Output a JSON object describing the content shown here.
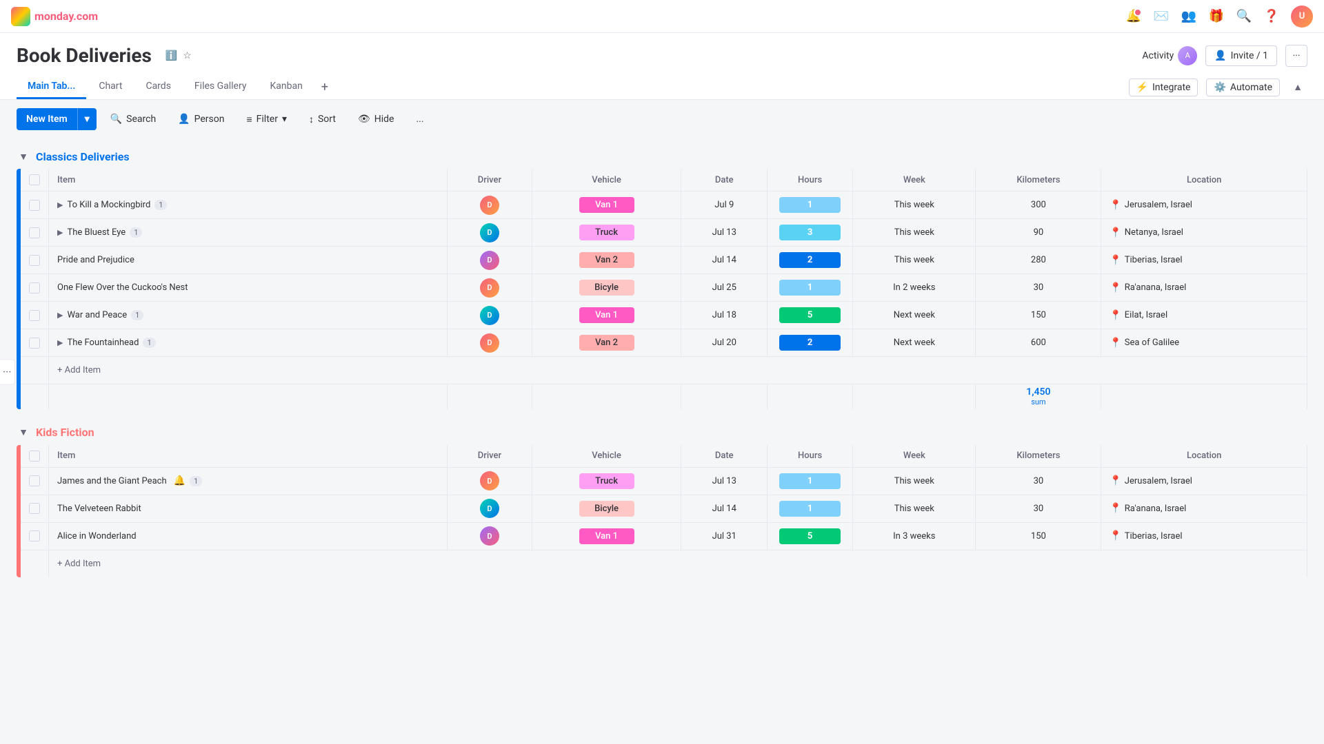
{
  "app": {
    "name": "monday.com"
  },
  "topnav": {
    "icons": [
      "bell",
      "inbox",
      "people",
      "gift",
      "search",
      "help"
    ]
  },
  "page": {
    "title": "Book Deliveries",
    "activity_label": "Activity",
    "invite_label": "Invite / 1",
    "more_label": "..."
  },
  "tabs": {
    "items": [
      {
        "label": "Main Tab...",
        "active": true
      },
      {
        "label": "Chart",
        "active": false
      },
      {
        "label": "Cards",
        "active": false
      },
      {
        "label": "Files Gallery",
        "active": false
      },
      {
        "label": "Kanban",
        "active": false
      }
    ],
    "integrate_label": "Integrate",
    "automate_label": "Automate"
  },
  "toolbar": {
    "new_item_label": "New Item",
    "search_label": "Search",
    "person_label": "Person",
    "filter_label": "Filter",
    "sort_label": "Sort",
    "hide_label": "Hide",
    "more_label": "..."
  },
  "groups": [
    {
      "id": "classics",
      "title": "Classics Deliveries",
      "color": "#0073ea",
      "columns": [
        "Item",
        "Driver",
        "Vehicle",
        "Date",
        "Hours",
        "Week",
        "Kilometers",
        "Location"
      ],
      "rows": [
        {
          "item": "To Kill a Mockingbird",
          "badge": "1",
          "expand": true,
          "vehicle": "Van 1",
          "vehicle_class": "van1",
          "date": "Jul 9",
          "hours": "1",
          "hours_class": "hours-1-light",
          "week": "This week",
          "km": "300",
          "location": "Jerusalem, Israel"
        },
        {
          "item": "The Bluest Eye",
          "badge": "1",
          "expand": true,
          "vehicle": "Truck",
          "vehicle_class": "truck",
          "date": "Jul 13",
          "hours": "3",
          "hours_class": "hours-3",
          "week": "This week",
          "km": "90",
          "location": "Netanya, Israel"
        },
        {
          "item": "Pride and Prejudice",
          "badge": "",
          "expand": false,
          "vehicle": "Van 2",
          "vehicle_class": "van2",
          "date": "Jul 14",
          "hours": "2",
          "hours_class": "hours-2-dark",
          "week": "This week",
          "km": "280",
          "location": "Tiberias, Israel"
        },
        {
          "item": "One Flew Over the Cuckoo's Nest",
          "badge": "",
          "expand": false,
          "vehicle": "Bicyle",
          "vehicle_class": "bicycle",
          "date": "Jul 25",
          "hours": "1",
          "hours_class": "hours-1-dark",
          "week": "In 2 weeks",
          "km": "30",
          "location": "Ra'anana, Israel"
        },
        {
          "item": "War and Peace",
          "badge": "1",
          "expand": true,
          "vehicle": "Van 1",
          "vehicle_class": "van1",
          "date": "Jul 18",
          "hours": "5",
          "hours_class": "hours-5",
          "week": "Next week",
          "km": "150",
          "location": "Eilat, Israel"
        },
        {
          "item": "The Fountainhead",
          "badge": "1",
          "expand": true,
          "vehicle": "Van 2",
          "vehicle_class": "van2",
          "date": "Jul 20",
          "hours": "2",
          "hours_class": "hours-2-blue",
          "week": "Next week",
          "km": "600",
          "location": "Sea of Galilee"
        }
      ],
      "add_item_label": "+ Add Item",
      "sum_km": "1,450",
      "sum_label": "sum"
    },
    {
      "id": "kids",
      "title": "Kids Fiction",
      "color": "#ff7575",
      "columns": [
        "Item",
        "Driver",
        "Vehicle",
        "Date",
        "Hours",
        "Week",
        "Kilometers",
        "Location"
      ],
      "rows": [
        {
          "item": "James and the Giant Peach",
          "badge": "",
          "expand": false,
          "vehicle": "Truck",
          "vehicle_class": "truck",
          "date": "Jul 13",
          "hours": "1",
          "hours_class": "hours-1-light",
          "week": "This week",
          "km": "30",
          "location": "Jerusalem, Israel",
          "has_notification": true
        },
        {
          "item": "The Velveteen Rabbit",
          "badge": "",
          "expand": false,
          "vehicle": "Bicyle",
          "vehicle_class": "bicycle",
          "date": "Jul 14",
          "hours": "1",
          "hours_class": "hours-1-light",
          "week": "This week",
          "km": "30",
          "location": "Ra'anana, Israel"
        },
        {
          "item": "Alice in Wonderland",
          "badge": "",
          "expand": false,
          "vehicle": "Van 1",
          "vehicle_class": "van1",
          "date": "Jul 31",
          "hours": "5",
          "hours_class": "hours-5",
          "week": "In 3 weeks",
          "km": "150",
          "location": "Tiberias, Israel"
        }
      ],
      "add_item_label": "+ Add Item",
      "sum_km": "",
      "sum_label": ""
    }
  ]
}
